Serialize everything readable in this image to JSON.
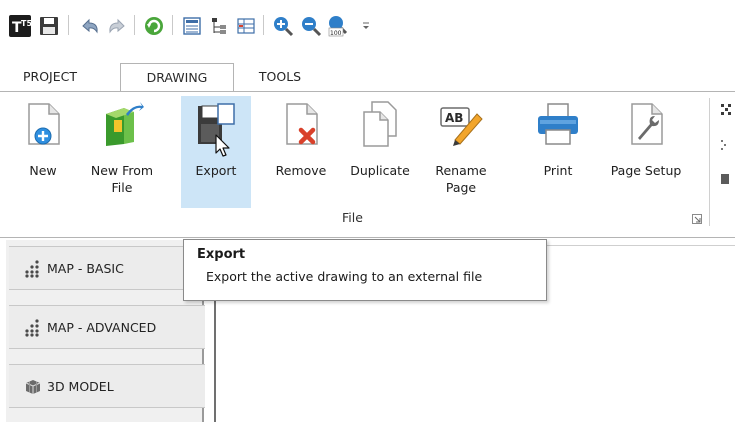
{
  "quick_access": {
    "items": [
      {
        "icon": "app-logo-icon",
        "label": "T5"
      },
      {
        "icon": "save-icon"
      },
      {
        "icon": "undo-icon"
      },
      {
        "icon": "redo-icon"
      },
      {
        "icon": "refresh-icon"
      },
      {
        "icon": "list-view-icon"
      },
      {
        "icon": "tree-view-icon"
      },
      {
        "icon": "grid-view-icon"
      },
      {
        "icon": "zoom-in-icon"
      },
      {
        "icon": "zoom-out-icon"
      },
      {
        "icon": "zoom-100-icon",
        "label": "100"
      },
      {
        "icon": "customize-dropdown-icon"
      }
    ]
  },
  "ribbon_tabs": [
    {
      "label": "PROJECT",
      "active": false
    },
    {
      "label": "DRAWING",
      "active": true
    },
    {
      "label": "TOOLS",
      "active": false
    }
  ],
  "file_group": {
    "label": "File",
    "buttons": [
      {
        "label": "New",
        "icon": "new-document-icon"
      },
      {
        "label": "New From\nFile",
        "icon": "new-from-file-icon"
      },
      {
        "label": "Export",
        "icon": "export-icon",
        "highlighted": true
      },
      {
        "label": "Remove",
        "icon": "remove-document-icon"
      },
      {
        "label": "Duplicate",
        "icon": "duplicate-icon"
      },
      {
        "label": "Rename\nPage",
        "icon": "rename-icon",
        "badge": "AB"
      },
      {
        "label": "Print",
        "icon": "printer-icon"
      },
      {
        "label": "Page Setup",
        "icon": "page-setup-icon"
      }
    ]
  },
  "left_panel": {
    "items": [
      {
        "label": "MAP - BASIC",
        "icon": "map-grid-icon"
      },
      {
        "label": "MAP - ADVANCED",
        "icon": "map-grid-icon"
      },
      {
        "label": "3D MODEL",
        "icon": "3d-model-icon"
      }
    ]
  },
  "tooltip": {
    "title": "Export",
    "description": "Export the active drawing to an external file"
  },
  "colors": {
    "highlight": "#cde5f7",
    "accent_blue": "#1f7bd0",
    "accent_green": "#3a9a2c",
    "remove_red": "#d9412b"
  }
}
